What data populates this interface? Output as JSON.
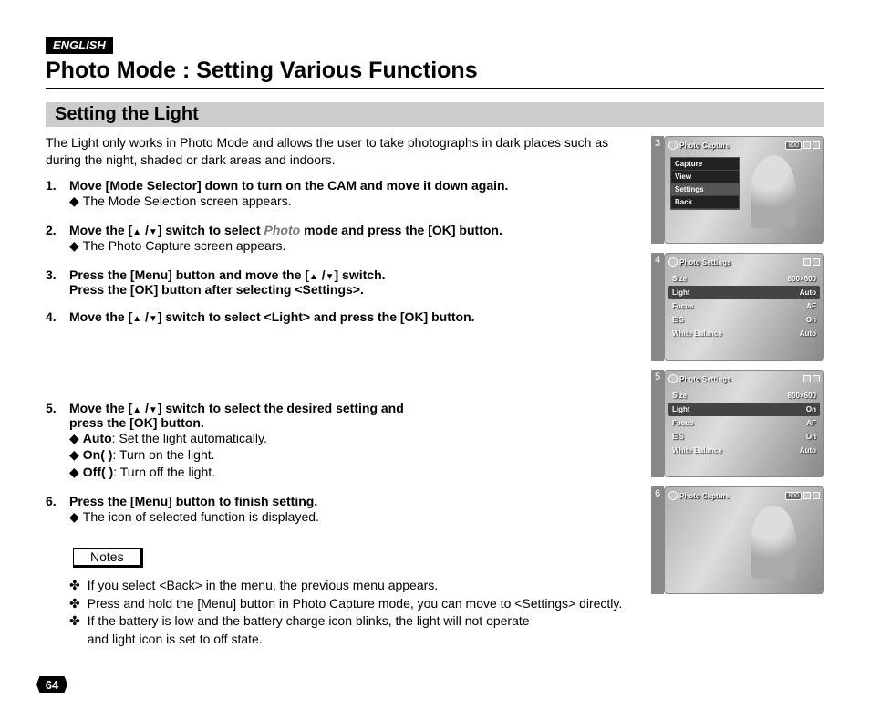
{
  "language_badge": "ENGLISH",
  "page_title": "Photo Mode : Setting Various Functions",
  "section_title": "Setting the Light",
  "intro": "The Light only works in Photo Mode and allows the user to take photographs in dark places such as during the night, shaded or dark areas and indoors.",
  "steps": {
    "s1": {
      "num": "1.",
      "text": "Move [Mode Selector] down to turn on the CAM and move it down again.",
      "sub1": "The Mode Selection screen appears."
    },
    "s2": {
      "num": "2.",
      "text_a": "Move the [",
      "text_b": "] switch to select ",
      "photo": "Photo",
      "text_c": " mode and press the [OK] button.",
      "sub1": "The Photo Capture screen appears."
    },
    "s3": {
      "num": "3.",
      "line1_a": "Press the [Menu] button and move the [",
      "line1_b": "] switch.",
      "line2": "Press the [OK] button after selecting <Settings>."
    },
    "s4": {
      "num": "4.",
      "text_a": "Move the [",
      "text_b": "] switch to select <Light> and press the [OK] button."
    },
    "s5": {
      "num": "5.",
      "line1_a": "Move the [",
      "line1_b": "] switch to select the desired setting and",
      "line2": "press the [OK] button.",
      "sub1_b": "Auto",
      "sub1_t": ": Set the light automatically.",
      "sub2_b": "On(   )",
      "sub2_t": ": Turn on the light.",
      "sub3_b": "Off(    )",
      "sub3_t": ": Turn off the light."
    },
    "s6": {
      "num": "6.",
      "text": "Press the [Menu] button to finish setting.",
      "sub1": "The icon of selected function is displayed."
    }
  },
  "notes_label": "Notes",
  "notes": {
    "n1": "If you select <Back> in the menu, the previous menu appears.",
    "n2": "Press and hold the [Menu] button in Photo Capture mode, you can move to <Settings> directly.",
    "n3": "If the battery is low and the battery charge icon blinks, the light will not operate",
    "n3b": "and light icon is set to off state."
  },
  "page_number": "64",
  "screens": {
    "s3": {
      "label": "3",
      "title": "Photo Capture",
      "badge": "800",
      "menu": [
        "Capture",
        "View",
        "Settings",
        "Back"
      ],
      "menu_sel": 2
    },
    "s4": {
      "label": "4",
      "title": "Photo Settings",
      "rows": [
        {
          "k": "Size",
          "v": "800×600"
        },
        {
          "k": "Light",
          "v": "Auto"
        },
        {
          "k": "Focus",
          "v": "AF"
        },
        {
          "k": "EIS",
          "v": "On"
        },
        {
          "k": "White Balance",
          "v": "Auto"
        }
      ],
      "hi": 1
    },
    "s5": {
      "label": "5",
      "title": "Photo Settings",
      "rows": [
        {
          "k": "Size",
          "v": "800×600"
        },
        {
          "k": "Light",
          "v": "On"
        },
        {
          "k": "Focus",
          "v": "AF"
        },
        {
          "k": "EIS",
          "v": "On"
        },
        {
          "k": "White Balance",
          "v": "Auto"
        }
      ],
      "hi": 1
    },
    "s6": {
      "label": "6",
      "title": "Photo Capture",
      "badge": "800"
    }
  }
}
